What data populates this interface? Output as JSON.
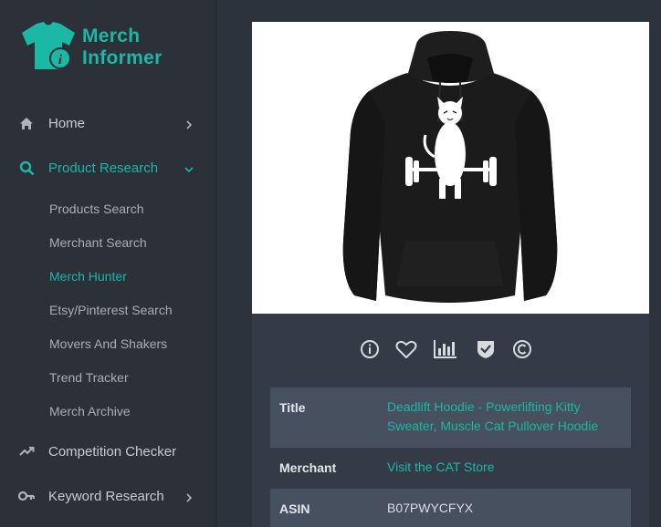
{
  "brand": {
    "name_line1": "Merch",
    "name_line2": "Informer",
    "color": "#1ab8a5"
  },
  "sidebar": {
    "items": [
      {
        "label": "Home",
        "icon": "home-icon"
      },
      {
        "label": "Product Research",
        "icon": "search-icon",
        "active": true
      },
      {
        "label": "Competition Checker",
        "icon": "trend-up-icon"
      },
      {
        "label": "Keyword Research",
        "icon": "key-icon"
      }
    ],
    "subitems": [
      {
        "label": "Products Search"
      },
      {
        "label": "Merchant Search"
      },
      {
        "label": "Merch Hunter",
        "active": true
      },
      {
        "label": "Etsy/Pinterest Search"
      },
      {
        "label": "Movers And Shakers"
      },
      {
        "label": "Trend Tracker"
      },
      {
        "label": "Merch Archive"
      }
    ]
  },
  "product": {
    "image_desc_icon": "hoodie-product-image",
    "actions": [
      {
        "name": "info-icon"
      },
      {
        "name": "heart-icon"
      },
      {
        "name": "bar-chart-icon"
      },
      {
        "name": "shield-check-icon"
      },
      {
        "name": "copyright-icon"
      }
    ],
    "details": {
      "title_label": "Title",
      "title_value": "Deadlift Hoodie - Powerlifting Kitty Sweater, Muscle Cat Pullover Hoodie",
      "merchant_label": "Merchant",
      "merchant_value": "Visit the CAT Store",
      "asin_label": "ASIN",
      "asin_value": "B07PWYCFYX"
    }
  },
  "colors": {
    "accent": "#1ab8a5",
    "sidebar_bg": "#2c3039",
    "main_bg": "#2d333d",
    "card_bg": "#353b46",
    "row_shade": "#46505f"
  }
}
